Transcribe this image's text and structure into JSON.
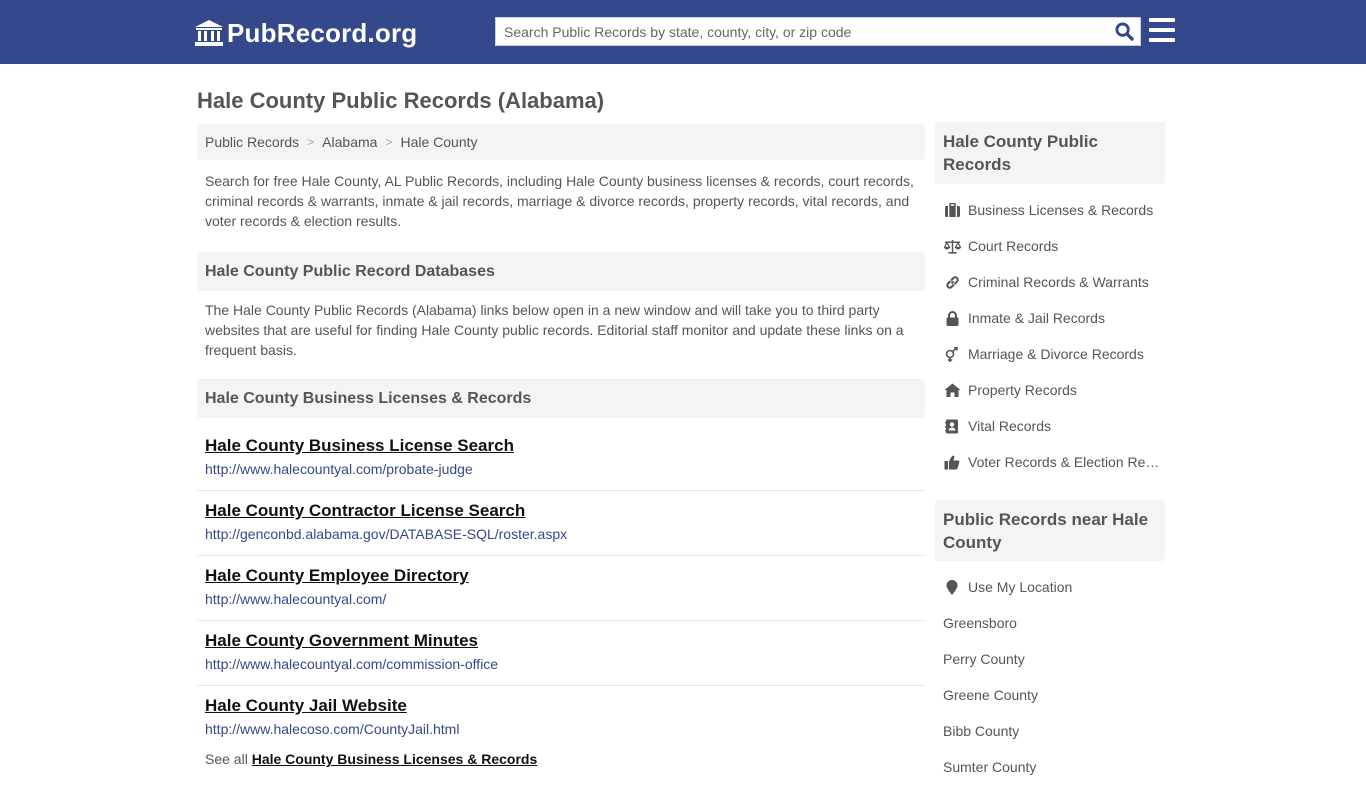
{
  "header": {
    "logo_text": "PubRecord.org",
    "search_placeholder": "Search Public Records by state, county, city, or zip code"
  },
  "page": {
    "title": "Hale County Public Records (Alabama)"
  },
  "breadcrumb": [
    "Public Records",
    "Alabama",
    "Hale County"
  ],
  "intro": "Search for free Hale County, AL Public Records, including Hale County business licenses & records, court records, criminal records & warrants, inmate & jail records, marriage & divorce records, property records, vital records, and voter records & election results.",
  "databases": {
    "heading": "Hale County Public Record Databases",
    "description": "The Hale County Public Records (Alabama) links below open in a new window and will take you to third party websites that are useful for finding Hale County public records. Editorial staff monitor and update these links on a frequent basis."
  },
  "business": {
    "heading": "Hale County Business Licenses & Records",
    "records": [
      {
        "title": "Hale County Business License Search",
        "url": "http://www.halecountyal.com/probate-judge"
      },
      {
        "title": "Hale County Contractor License Search",
        "url": "http://genconbd.alabama.gov/DATABASE-SQL/roster.aspx"
      },
      {
        "title": "Hale County Employee Directory",
        "url": "http://www.halecountyal.com/"
      },
      {
        "title": "Hale County Government Minutes",
        "url": "http://www.halecountyal.com/commission-office"
      },
      {
        "title": "Hale County Jail Website",
        "url": "http://www.halecoso.com/CountyJail.html"
      }
    ],
    "see_all_prefix": "See all",
    "see_all_link": "Hale County Business Licenses & Records"
  },
  "sidebar": {
    "records_heading": "Hale County Public Records",
    "records_items": [
      {
        "label": "Business Licenses & Records",
        "icon": "briefcase-icon"
      },
      {
        "label": "Court Records",
        "icon": "scales-icon"
      },
      {
        "label": "Criminal Records & Warrants",
        "icon": "link-icon"
      },
      {
        "label": "Inmate & Jail Records",
        "icon": "lock-icon"
      },
      {
        "label": "Marriage & Divorce Records",
        "icon": "gender-icon"
      },
      {
        "label": "Property Records",
        "icon": "home-icon"
      },
      {
        "label": "Vital Records",
        "icon": "contact-book-icon"
      },
      {
        "label": "Voter Records & Election Results",
        "icon": "thumbs-up-icon"
      }
    ],
    "near_heading": "Public Records near Hale County",
    "use_location": "Use My Location",
    "near_items": [
      "Greensboro",
      "Perry County",
      "Greene County",
      "Bibb County",
      "Sumter County"
    ]
  },
  "colors": {
    "header_bg": "#34488c",
    "link": "#34488c",
    "panel_bg": "#f4f4f4",
    "text": "#555555"
  }
}
